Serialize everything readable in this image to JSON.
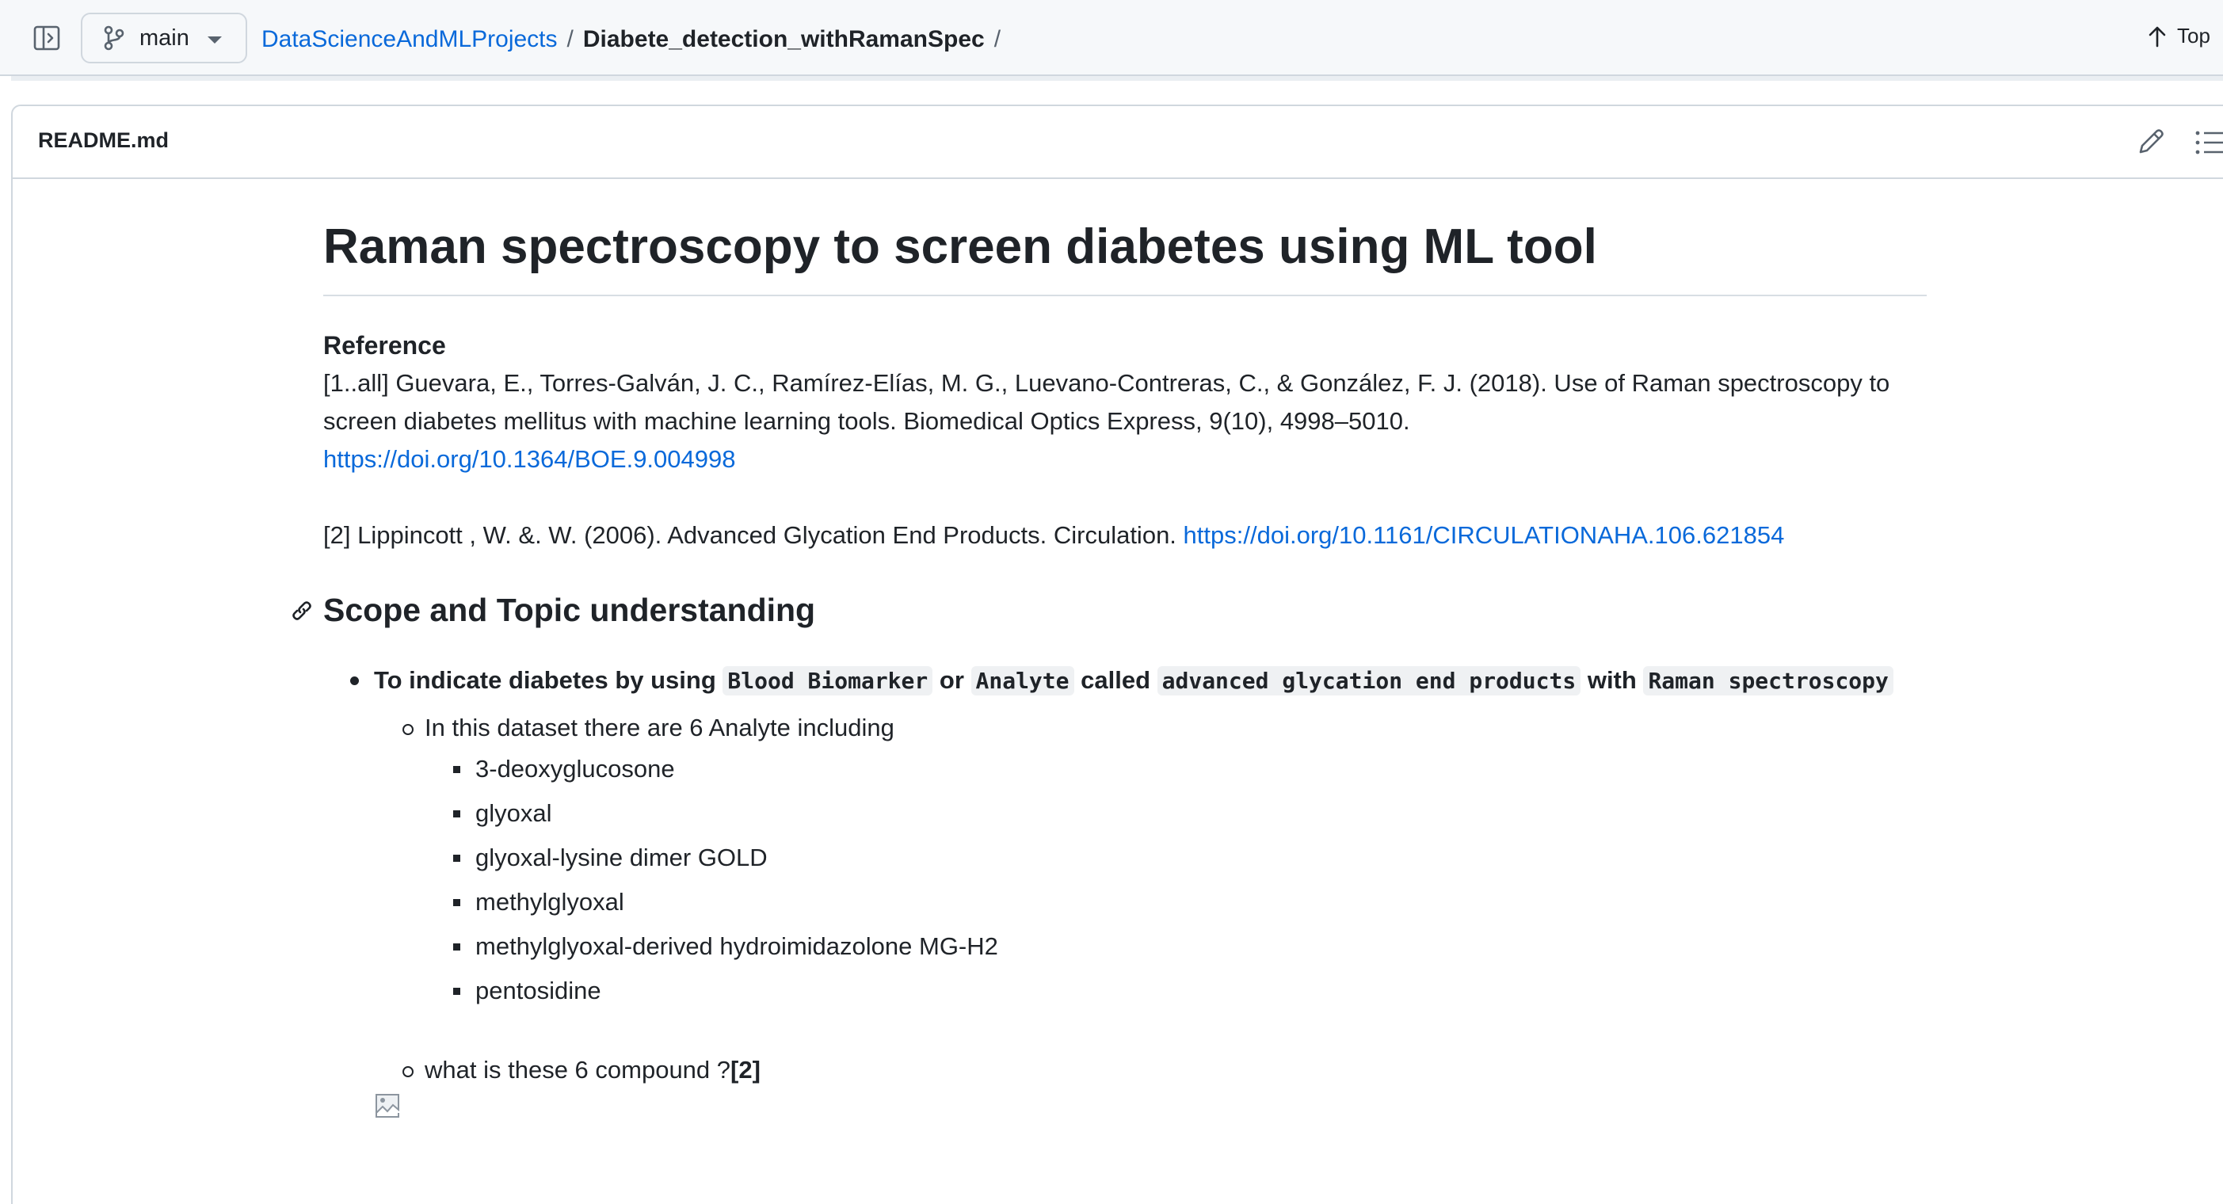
{
  "topbar": {
    "branch": "main",
    "repo": "DataScienceAndMLProjects",
    "separator": "/",
    "folder": "Diabete_detection_withRamanSpec",
    "trailing_separator": "/",
    "top_label": "Top"
  },
  "readme": {
    "filename": "README.md",
    "title": "Raman spectroscopy to screen diabetes using ML tool",
    "reference_heading": "Reference",
    "ref1_text": "[1..all] Guevara, E., Torres-Galván, J. C., Ramírez-Elías, M. G., Luevano-Contreras, C., & González, F. J. (2018). Use of Raman spectroscopy to screen diabetes mellitus with machine learning tools. Biomedical Optics Express, 9(10), 4998–5010.",
    "ref1_link": "https://doi.org/10.1364/BOE.9.004998",
    "ref2_text": "[2] Lippincott , W. &. W. (2006). Advanced Glycation End Products. Circulation.",
    "ref2_link": "https://doi.org/10.1161/CIRCULATIONAHA.106.621854",
    "section_heading": "Scope and Topic understanding",
    "bullet1": {
      "t1": "To indicate diabetes by using ",
      "c1": "Blood Biomarker",
      "t2": " or ",
      "c2": "Analyte",
      "t3": " called ",
      "c3": "advanced glycation end products",
      "t4": " with ",
      "c4": "Raman spectroscopy"
    },
    "sub1": "In this dataset there are 6 Analyte including",
    "analytes": [
      "3-deoxyglucosone",
      "glyoxal",
      "glyoxal-lysine dimer GOLD",
      "methylglyoxal",
      "methylglyoxal-derived hydroimidazolone MG-H2",
      "pentosidine"
    ],
    "sub2_text": "what is these 6 compound ?",
    "sub2_ref": "[2]"
  }
}
